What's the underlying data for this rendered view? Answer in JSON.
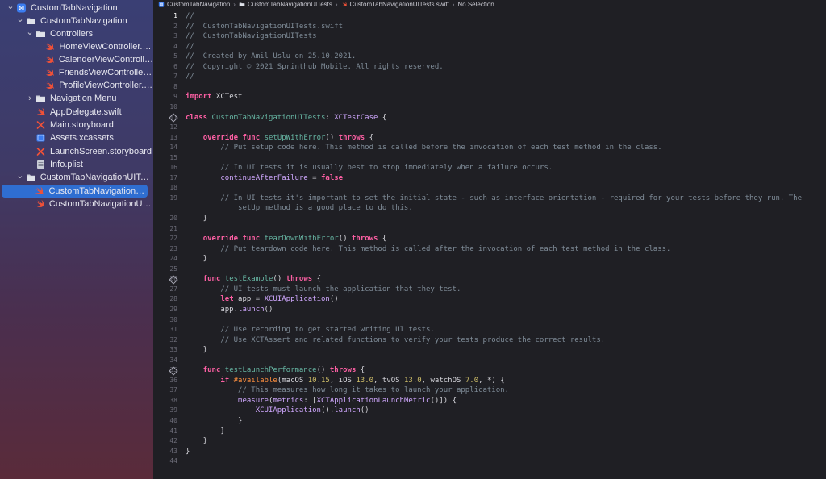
{
  "colors": {
    "accent": "#2f6ed1",
    "swift": "#f05138",
    "keyword": "#fc5fa3",
    "comment": "#7f8c98",
    "function": "#67b7a4",
    "type": "#d0a8ff",
    "number": "#d0bf69"
  },
  "breadcrumb": [
    {
      "label": "CustomTabNavigation",
      "icon": "project-icon"
    },
    {
      "label": "CustomTabNavigationUITests",
      "icon": "folder-icon"
    },
    {
      "label": "CustomTabNavigationUITests.swift",
      "icon": "swift-file-icon"
    },
    {
      "label": "No Selection",
      "icon": ""
    }
  ],
  "navigator": [
    {
      "label": "CustomTabNavigation",
      "icon": "project-icon",
      "chevron": "open",
      "indent": 0,
      "name": "nav-project"
    },
    {
      "label": "CustomTabNavigation",
      "icon": "folder-icon",
      "chevron": "open",
      "indent": 1,
      "name": "nav-group-app"
    },
    {
      "label": "Controllers",
      "icon": "folder-icon",
      "chevron": "open",
      "indent": 2,
      "name": "nav-group-controllers"
    },
    {
      "label": "HomeViewController.swift",
      "icon": "swift-file-icon",
      "chevron": "",
      "indent": 3,
      "name": "nav-file-home"
    },
    {
      "label": "CalenderViewController.s...",
      "icon": "swift-file-icon",
      "chevron": "",
      "indent": 3,
      "name": "nav-file-calender"
    },
    {
      "label": "FriendsViewController.sw...",
      "icon": "swift-file-icon",
      "chevron": "",
      "indent": 3,
      "name": "nav-file-friends"
    },
    {
      "label": "ProfileViewController.swift",
      "icon": "swift-file-icon",
      "chevron": "",
      "indent": 3,
      "name": "nav-file-profile"
    },
    {
      "label": "Navigation Menu",
      "icon": "folder-icon",
      "chevron": "closed",
      "indent": 2,
      "name": "nav-group-navigation-menu"
    },
    {
      "label": "AppDelegate.swift",
      "icon": "swift-file-icon",
      "chevron": "",
      "indent": 2,
      "name": "nav-file-appdelegate"
    },
    {
      "label": "Main.storyboard",
      "icon": "storyboard-icon",
      "chevron": "",
      "indent": 2,
      "name": "nav-file-main-storyboard"
    },
    {
      "label": "Assets.xcassets",
      "icon": "assets-icon",
      "chevron": "",
      "indent": 2,
      "name": "nav-file-assets"
    },
    {
      "label": "LaunchScreen.storyboard",
      "icon": "storyboard-icon",
      "chevron": "",
      "indent": 2,
      "name": "nav-file-launchscreen"
    },
    {
      "label": "Info.plist",
      "icon": "plist-icon",
      "chevron": "",
      "indent": 2,
      "name": "nav-file-infoplist"
    },
    {
      "label": "CustomTabNavigationUITests",
      "icon": "folder-icon",
      "chevron": "open",
      "indent": 1,
      "name": "nav-group-uitests"
    },
    {
      "label": "CustomTabNavigationUITes...",
      "icon": "swift-file-icon",
      "chevron": "",
      "indent": 2,
      "name": "nav-file-uitests",
      "selected": true
    },
    {
      "label": "CustomTabNavigationUITes...",
      "icon": "swift-file-icon",
      "chevron": "",
      "indent": 2,
      "name": "nav-file-uitests-launch"
    }
  ],
  "editor": {
    "active_line": 1,
    "lines": [
      {
        "n": "1",
        "diamond": false,
        "tokens": [
          [
            "cm",
            "//"
          ]
        ]
      },
      {
        "n": "2",
        "diamond": false,
        "tokens": [
          [
            "cm",
            "//  CustomTabNavigationUITests.swift"
          ]
        ]
      },
      {
        "n": "3",
        "diamond": false,
        "tokens": [
          [
            "cm",
            "//  CustomTabNavigationUITests"
          ]
        ]
      },
      {
        "n": "4",
        "diamond": false,
        "tokens": [
          [
            "cm",
            "//"
          ]
        ]
      },
      {
        "n": "5",
        "diamond": false,
        "tokens": [
          [
            "cm",
            "//  Created by Amil Uslu on 25.10.2021."
          ]
        ]
      },
      {
        "n": "6",
        "diamond": false,
        "tokens": [
          [
            "cm",
            "//  Copyright © 2021 Sprinthub Mobile. All rights reserved."
          ]
        ]
      },
      {
        "n": "7",
        "diamond": false,
        "tokens": [
          [
            "cm",
            "//"
          ]
        ]
      },
      {
        "n": "8",
        "diamond": false,
        "tokens": []
      },
      {
        "n": "9",
        "diamond": false,
        "tokens": [
          [
            "kw",
            "import"
          ],
          [
            "",
            " XCTest"
          ]
        ]
      },
      {
        "n": "10",
        "diamond": false,
        "tokens": []
      },
      {
        "n": "11",
        "diamond": true,
        "tokens": [
          [
            "kw",
            "class"
          ],
          [
            "",
            " "
          ],
          [
            "fn",
            "CustomTabNavigationUITests"
          ],
          [
            "",
            ": "
          ],
          [
            "ty",
            "XCTestCase"
          ],
          [
            "",
            " {"
          ]
        ]
      },
      {
        "n": "12",
        "diamond": false,
        "tokens": []
      },
      {
        "n": "13",
        "diamond": false,
        "tokens": [
          [
            "",
            "    "
          ],
          [
            "kw",
            "override func"
          ],
          [
            "",
            " "
          ],
          [
            "fn",
            "setUpWithError"
          ],
          [
            "",
            "() "
          ],
          [
            "kw",
            "throws"
          ],
          [
            "",
            " {"
          ]
        ]
      },
      {
        "n": "14",
        "diamond": false,
        "tokens": [
          [
            "cm",
            "        // Put setup code here. This method is called before the invocation of each test method in the class."
          ]
        ]
      },
      {
        "n": "15",
        "diamond": false,
        "tokens": []
      },
      {
        "n": "16",
        "diamond": false,
        "tokens": [
          [
            "cm",
            "        // In UI tests it is usually best to stop immediately when a failure occurs."
          ]
        ]
      },
      {
        "n": "17",
        "diamond": false,
        "tokens": [
          [
            "",
            "        "
          ],
          [
            "ty",
            "continueAfterFailure"
          ],
          [
            "",
            " = "
          ],
          [
            "kw",
            "false"
          ]
        ]
      },
      {
        "n": "18",
        "diamond": false,
        "tokens": []
      },
      {
        "n": "19",
        "diamond": false,
        "tokens": [
          [
            "cm",
            "        // In UI tests it's important to set the initial state - such as interface orientation - required for your tests before they run. The"
          ]
        ]
      },
      {
        "n": "",
        "diamond": false,
        "tokens": [
          [
            "cm",
            "            setUp method is a good place to do this."
          ]
        ]
      },
      {
        "n": "20",
        "diamond": false,
        "tokens": [
          [
            "",
            "    }"
          ]
        ]
      },
      {
        "n": "21",
        "diamond": false,
        "tokens": []
      },
      {
        "n": "22",
        "diamond": false,
        "tokens": [
          [
            "",
            "    "
          ],
          [
            "kw",
            "override func"
          ],
          [
            "",
            " "
          ],
          [
            "fn",
            "tearDownWithError"
          ],
          [
            "",
            "() "
          ],
          [
            "kw",
            "throws"
          ],
          [
            "",
            " {"
          ]
        ]
      },
      {
        "n": "23",
        "diamond": false,
        "tokens": [
          [
            "cm",
            "        // Put teardown code here. This method is called after the invocation of each test method in the class."
          ]
        ]
      },
      {
        "n": "24",
        "diamond": false,
        "tokens": [
          [
            "",
            "    }"
          ]
        ]
      },
      {
        "n": "25",
        "diamond": false,
        "tokens": []
      },
      {
        "n": "26",
        "diamond": true,
        "tokens": [
          [
            "",
            "    "
          ],
          [
            "kw",
            "func"
          ],
          [
            "",
            " "
          ],
          [
            "fn",
            "testExample"
          ],
          [
            "",
            "() "
          ],
          [
            "kw",
            "throws"
          ],
          [
            "",
            " {"
          ]
        ]
      },
      {
        "n": "27",
        "diamond": false,
        "tokens": [
          [
            "cm",
            "        // UI tests must launch the application that they test."
          ]
        ]
      },
      {
        "n": "28",
        "diamond": false,
        "tokens": [
          [
            "",
            "        "
          ],
          [
            "kw",
            "let"
          ],
          [
            "",
            " app = "
          ],
          [
            "ty",
            "XCUIApplication"
          ],
          [
            "",
            "()"
          ]
        ]
      },
      {
        "n": "29",
        "diamond": false,
        "tokens": [
          [
            "",
            "        app."
          ],
          [
            "ty",
            "launch"
          ],
          [
            "",
            "()"
          ]
        ]
      },
      {
        "n": "30",
        "diamond": false,
        "tokens": []
      },
      {
        "n": "31",
        "diamond": false,
        "tokens": [
          [
            "cm",
            "        // Use recording to get started writing UI tests."
          ]
        ]
      },
      {
        "n": "32",
        "diamond": false,
        "tokens": [
          [
            "cm",
            "        // Use XCTAssert and related functions to verify your tests produce the correct results."
          ]
        ]
      },
      {
        "n": "33",
        "diamond": false,
        "tokens": [
          [
            "",
            "    }"
          ]
        ]
      },
      {
        "n": "34",
        "diamond": false,
        "tokens": []
      },
      {
        "n": "35",
        "diamond": true,
        "tokens": [
          [
            "",
            "    "
          ],
          [
            "kw",
            "func"
          ],
          [
            "",
            " "
          ],
          [
            "fn",
            "testLaunchPerformance"
          ],
          [
            "",
            "() "
          ],
          [
            "kw",
            "throws"
          ],
          [
            "",
            " {"
          ]
        ]
      },
      {
        "n": "36",
        "diamond": false,
        "tokens": [
          [
            "",
            "        "
          ],
          [
            "kw",
            "if"
          ],
          [
            "",
            " "
          ],
          [
            "macro",
            "#available"
          ],
          [
            "",
            "(macOS "
          ],
          [
            "num",
            "10.15"
          ],
          [
            "",
            ", iOS "
          ],
          [
            "num",
            "13.0"
          ],
          [
            "",
            ", tvOS "
          ],
          [
            "num",
            "13.0"
          ],
          [
            "",
            ", watchOS "
          ],
          [
            "num",
            "7.0"
          ],
          [
            "",
            ", *) {"
          ]
        ]
      },
      {
        "n": "37",
        "diamond": false,
        "tokens": [
          [
            "cm",
            "            // This measures how long it takes to launch your application."
          ]
        ]
      },
      {
        "n": "38",
        "diamond": false,
        "tokens": [
          [
            "",
            "            "
          ],
          [
            "ty",
            "measure"
          ],
          [
            "",
            "("
          ],
          [
            "ty",
            "metrics"
          ],
          [
            "",
            ": ["
          ],
          [
            "ty",
            "XCTApplicationLaunchMetric"
          ],
          [
            "",
            "()]) {"
          ]
        ]
      },
      {
        "n": "39",
        "diamond": false,
        "tokens": [
          [
            "",
            "                "
          ],
          [
            "ty",
            "XCUIApplication"
          ],
          [
            "",
            "()."
          ],
          [
            "ty",
            "launch"
          ],
          [
            "",
            "()"
          ]
        ]
      },
      {
        "n": "40",
        "diamond": false,
        "tokens": [
          [
            "",
            "            }"
          ]
        ]
      },
      {
        "n": "41",
        "diamond": false,
        "tokens": [
          [
            "",
            "        }"
          ]
        ]
      },
      {
        "n": "42",
        "diamond": false,
        "tokens": [
          [
            "",
            "    }"
          ]
        ]
      },
      {
        "n": "43",
        "diamond": false,
        "tokens": [
          [
            "",
            "}"
          ]
        ]
      },
      {
        "n": "44",
        "diamond": false,
        "tokens": []
      }
    ]
  }
}
